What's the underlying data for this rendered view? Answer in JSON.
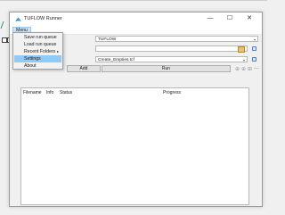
{
  "window": {
    "title": "TUFLOW Runner",
    "controls": {
      "minimize": "—",
      "maximize": "☐",
      "close": "✕"
    }
  },
  "menubar": {
    "menu_label": "Menu"
  },
  "dropdown": {
    "items": [
      {
        "label": "Save run queue",
        "has_submenu": false,
        "highlighted": false
      },
      {
        "label": "Load run queue",
        "has_submenu": false,
        "highlighted": false
      },
      {
        "label": "Recent Folders",
        "has_submenu": true,
        "highlighted": false,
        "submenu_arrow": "▸"
      },
      {
        "label": "Settings",
        "has_submenu": false,
        "highlighted": true
      },
      {
        "label": "About",
        "has_submenu": false,
        "highlighted": false
      }
    ]
  },
  "form": {
    "engine_select": {
      "value": "TUFLOW"
    },
    "folder_input": {
      "value": ""
    },
    "tcf_select": {
      "value": "Create_Empties.tcf"
    },
    "add_button": "Add",
    "run_button": "Run"
  },
  "table": {
    "columns": [
      "Filename",
      "Info",
      "Status",
      "Progress"
    ],
    "rows": []
  },
  "colors": {
    "menu_highlight": "#91c9f7",
    "menu_active": "#cce4f7",
    "folder_icon": "#e9c46a"
  }
}
